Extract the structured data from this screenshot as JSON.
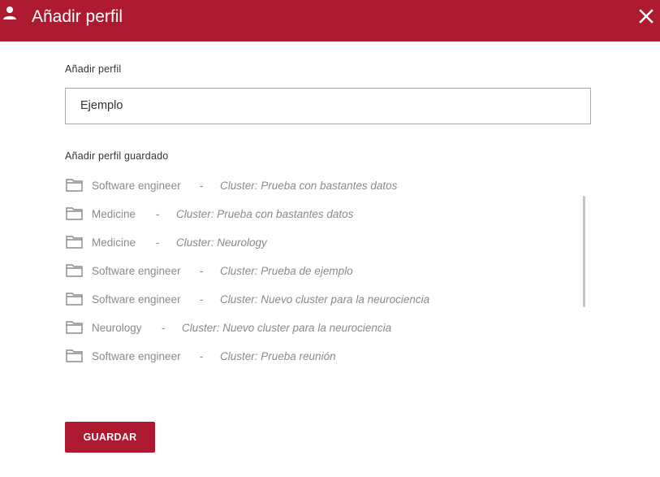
{
  "header": {
    "title": "Añadir perfil",
    "person_icon": "person-icon",
    "close_icon": "close-icon"
  },
  "form": {
    "profile_label": "Añadir perfil",
    "profile_value": "Ejemplo",
    "saved_label": "Añadir perfil guardado"
  },
  "saved_profiles": [
    {
      "name": "Software engineer",
      "separator": "-",
      "cluster": "Cluster: Prueba con bastantes datos"
    },
    {
      "name": "Medicine",
      "separator": "-",
      "cluster": "Cluster: Prueba con bastantes datos"
    },
    {
      "name": "Medicine",
      "separator": "-",
      "cluster": "Cluster: Neurology"
    },
    {
      "name": "Software engineer",
      "separator": "-",
      "cluster": "Cluster: Prueba de ejemplo"
    },
    {
      "name": "Software engineer",
      "separator": "-",
      "cluster": "Cluster: Nuevo cluster para la neurociencia"
    },
    {
      "name": "Neurology",
      "separator": "-",
      "cluster": "Cluster: Nuevo cluster para la neurociencia"
    },
    {
      "name": "Software engineer",
      "separator": "-",
      "cluster": "Cluster: Prueba reunión"
    }
  ],
  "actions": {
    "save_label": "GUARDAR"
  },
  "colors": {
    "accent": "#ad1a2f",
    "muted_text": "#8a8a8a",
    "label_text": "#333333"
  }
}
